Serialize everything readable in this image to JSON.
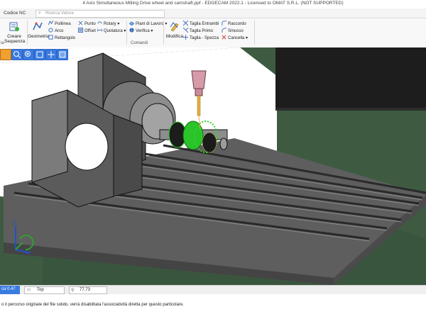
{
  "window": {
    "title": "4 Axis Simultaneous Milling Drive wheel and camshaft.ppf - EDGECAM 2022.1 - Licensed to OMAT S.R.L. (NOT SUPPORTED)"
  },
  "tabs": {
    "nc": "Codice NC"
  },
  "search": {
    "placeholder": "Ricerca Veloce"
  },
  "ribbon": {
    "crea_sequenza": "Creare Sequenza",
    "geometria": "Geometria",
    "polilinea": "Polilinea",
    "arco": "Arco",
    "rettangolo": "Rettangolo",
    "punto": "Punto",
    "offset": "Offset",
    "rotary": "Rotary",
    "quotatura": "Quotatura",
    "piani": "Piani di Lavoro",
    "verifica": "Verifica",
    "modifica": "Modifica",
    "taglia_entrambi": "Taglia Entrambi",
    "taglia_primo": "Taglia Primo",
    "taglia_spezza": "Taglia - Spezza",
    "raccordo": "Raccordo",
    "smusso": "Smusso",
    "cancella": "Cancella",
    "group_comandi": "Comandi",
    "group_left": "ia"
  },
  "status": {
    "tolerance": "ca 0.47",
    "view": "Top",
    "zoom": "77.73"
  },
  "message": "o il percorso originale del file solido, verrà disabilitata l'associatività diretta per questo particolare.",
  "colors": {
    "bg": "#ffffff",
    "floor": "#3d5a41",
    "table": "#6a6a6a",
    "tool": "#d49aa8",
    "part_green": "#32d12a"
  }
}
